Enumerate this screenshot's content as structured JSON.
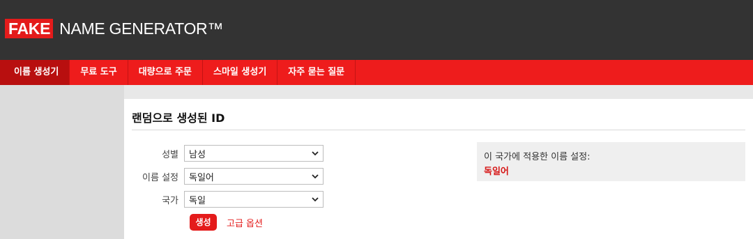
{
  "logo": {
    "badge": "FAKE",
    "text": "NAME GENERATOR™"
  },
  "nav": {
    "items": [
      {
        "label": "이름 생성기",
        "active": true
      },
      {
        "label": "무료 도구"
      },
      {
        "label": "대량으로 주문"
      },
      {
        "label": "스마일 생성기"
      },
      {
        "label": "자주 묻는 질문"
      }
    ]
  },
  "panel": {
    "title": "랜덤으로 생성된 ID",
    "form": {
      "gender": {
        "label": "성별",
        "value": "남성"
      },
      "name_set": {
        "label": "이름 설정",
        "value": "독일어"
      },
      "country": {
        "label": "국가",
        "value": "독일"
      }
    },
    "generate_label": "생성",
    "advanced_label": "고급 옵션",
    "info": {
      "heading": "이 국가에 적용한 이름 설정:",
      "value": "독일어"
    }
  },
  "colors": {
    "header_bg": "#333333",
    "accent_red": "#e41b1b",
    "nav_active": "#b80f0f"
  }
}
